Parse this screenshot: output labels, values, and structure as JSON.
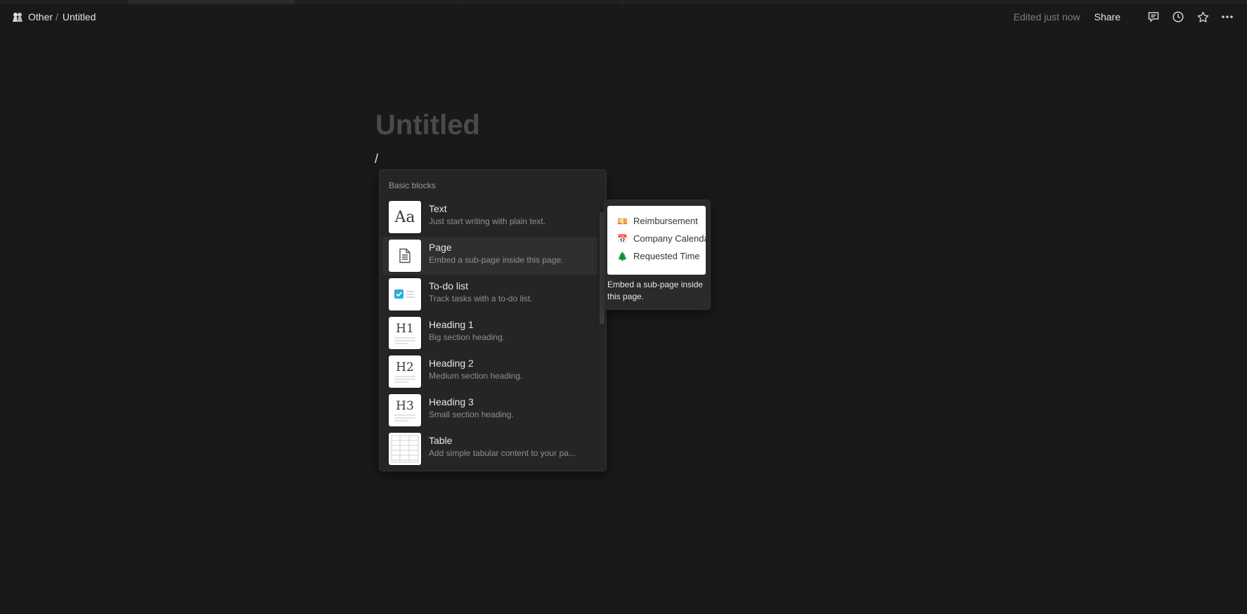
{
  "topbar": {
    "breadcrumbs": [
      "Other",
      "Untitled"
    ],
    "separator": "/",
    "edited": "Edited just now",
    "share": "Share"
  },
  "page": {
    "title_placeholder": "Untitled",
    "slash": "/"
  },
  "menu": {
    "section": "Basic blocks",
    "items": [
      {
        "name": "Text",
        "desc": "Just start writing with plain text.",
        "icon": "text-icon"
      },
      {
        "name": "Page",
        "desc": "Embed a sub-page inside this page.",
        "icon": "page-icon"
      },
      {
        "name": "To-do list",
        "desc": "Track tasks with a to-do list.",
        "icon": "todo-icon"
      },
      {
        "name": "Heading 1",
        "desc": "Big section heading.",
        "icon": "heading1-icon"
      },
      {
        "name": "Heading 2",
        "desc": "Medium section heading.",
        "icon": "heading2-icon"
      },
      {
        "name": "Heading 3",
        "desc": "Small section heading.",
        "icon": "heading3-icon"
      },
      {
        "name": "Table",
        "desc": "Add simple tabular content to your pa...",
        "icon": "table-icon"
      }
    ],
    "thumb_labels": {
      "text": "Aa",
      "h1": "H1",
      "h2": "H2",
      "h3": "H3"
    }
  },
  "preview": {
    "rows": [
      {
        "emoji": "💴",
        "label": "Reimbursement"
      },
      {
        "emoji": "📅",
        "label": "Company Calendar"
      },
      {
        "emoji": "🌲",
        "label": "Requested Time"
      }
    ],
    "caption": "Embed a sub-page inside this page."
  },
  "colors": {
    "background": "#191919",
    "menu": "#252525",
    "selected": "#2f2f2f",
    "checkbox": "#2eaadc"
  }
}
